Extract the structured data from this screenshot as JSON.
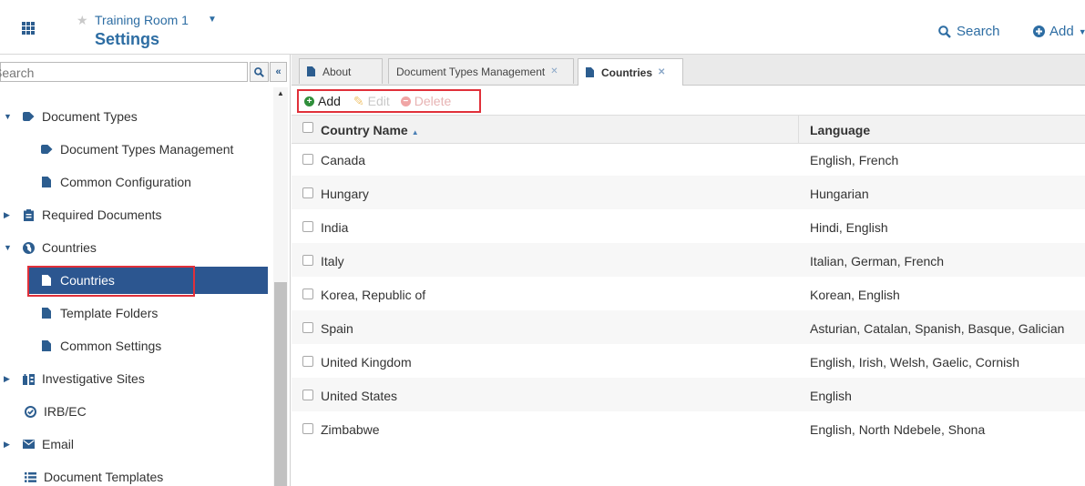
{
  "header": {
    "room_name": "Training Room 1",
    "page_title": "Settings",
    "search_label": "Search",
    "add_label": "Add"
  },
  "sidebar": {
    "search_placeholder": "Search",
    "items": [
      {
        "label": "Document Types",
        "icon": "tag-icon",
        "level": 0,
        "expanded": true
      },
      {
        "label": "Document Types Management",
        "icon": "tag-icon",
        "level": 1
      },
      {
        "label": "Common Configuration",
        "icon": "document-icon",
        "level": 1
      },
      {
        "label": "Required Documents",
        "icon": "clipboard-icon",
        "level": 0,
        "expanded": false
      },
      {
        "label": "Countries",
        "icon": "globe-icon",
        "level": 0,
        "expanded": true
      },
      {
        "label": "Countries",
        "icon": "document-icon",
        "level": 1,
        "selected": true
      },
      {
        "label": "Template Folders",
        "icon": "document-icon",
        "level": 1
      },
      {
        "label": "Common Settings",
        "icon": "document-icon",
        "level": 1
      },
      {
        "label": "Investigative Sites",
        "icon": "building-icon",
        "level": 0,
        "expanded": false
      },
      {
        "label": "IRB/EC",
        "icon": "check-circle-icon",
        "level": 0
      },
      {
        "label": "Email",
        "icon": "envelope-icon",
        "level": 0,
        "expanded": false
      },
      {
        "label": "Document Templates",
        "icon": "list-icon",
        "level": 0
      }
    ]
  },
  "tabs": [
    {
      "label": "About",
      "closable": false,
      "active": false
    },
    {
      "label": "Document Types Management",
      "closable": true,
      "active": false
    },
    {
      "label": "Countries",
      "closable": true,
      "active": true
    }
  ],
  "toolbar": {
    "add_label": "Add",
    "edit_label": "Edit",
    "delete_label": "Delete"
  },
  "grid": {
    "columns": [
      "Country Name",
      "Language"
    ],
    "rows": [
      {
        "country": "Canada",
        "language": "English, French"
      },
      {
        "country": "Hungary",
        "language": "Hungarian"
      },
      {
        "country": "India",
        "language": "Hindi, English"
      },
      {
        "country": "Italy",
        "language": "Italian, German, French"
      },
      {
        "country": "Korea, Republic of",
        "language": "Korean, English"
      },
      {
        "country": "Spain",
        "language": "Asturian, Catalan, Spanish, Basque, Galician"
      },
      {
        "country": "United Kingdom",
        "language": "English, Irish, Welsh, Gaelic, Cornish"
      },
      {
        "country": "United States",
        "language": "English"
      },
      {
        "country": "Zimbabwe",
        "language": "English, North Ndebele, Shona"
      }
    ]
  }
}
